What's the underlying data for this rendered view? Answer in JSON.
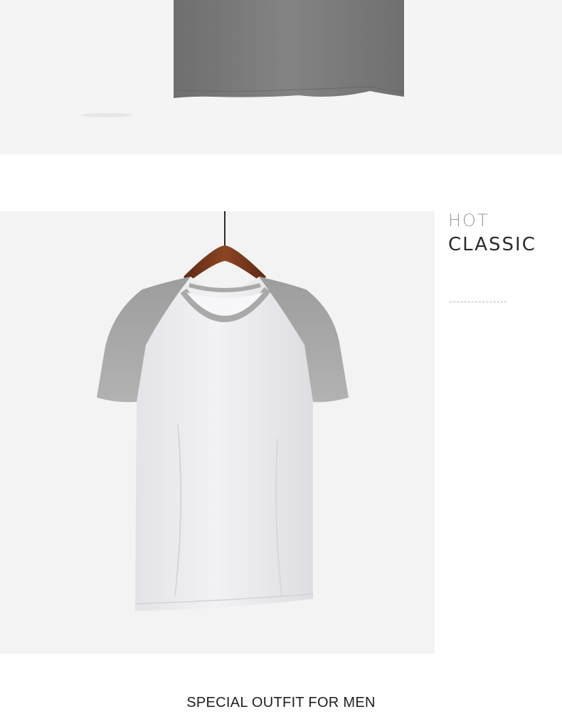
{
  "heading": {
    "line1": "HOT",
    "line2": "CLASSIC"
  },
  "caption": "SPECIAL OUTFIT FOR MEN",
  "colors": {
    "background": "#ffffff",
    "photo_background": "#f3f3f3",
    "dark_gray_shirt": "#7c7c7c",
    "raglan_sleeve_gray": "#a6a6a6",
    "shirt_body_white": "#ececef",
    "hanger_wood": "#7a3a1e"
  }
}
